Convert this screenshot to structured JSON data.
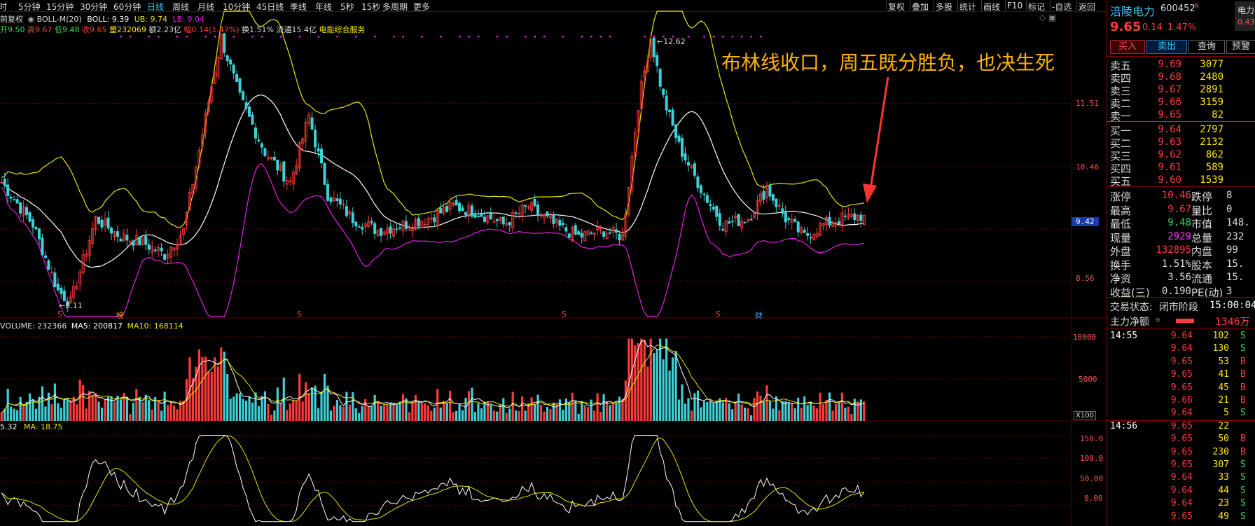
{
  "toolbar": {
    "periods": [
      "分时",
      "5分钟",
      "15分钟",
      "30分钟",
      "60分钟",
      "日线",
      "周线",
      "月线",
      "10分钟",
      "45日线",
      "季线",
      "年线",
      "5秒",
      "15秒",
      "多周期",
      "更多"
    ],
    "active_period": "日线",
    "tools": [
      "复权",
      "叠加",
      "多股",
      "统计",
      "画线",
      "F10",
      "标记",
      "-自选",
      "返回"
    ]
  },
  "main_panel": {
    "indicator_header": {
      "prefix": "前复权",
      "name": "BOLL-M(20)",
      "boll_label": "BOLL: 9.39",
      "ub_label": "UB: 9.74",
      "lb_label": "LB: 9.04"
    },
    "quote_line": {
      "open": "开9.50",
      "high": "高9.67",
      "low": "低9.48",
      "close": "收9.65",
      "volume": "量232069",
      "amount": "额2.23亿",
      "change": "幅0.14(1.47%)",
      "turnover": "换1.51%",
      "float_cap": "流通15.4亿",
      "concept": "电能综合服务"
    },
    "annotation": "布林线收口，周五既分胜负，也决生死",
    "price_axis": [
      "11.51",
      "10.46",
      "9.42",
      "8.56"
    ],
    "current_price_tag": "9.42",
    "high_marker": "12.62",
    "low_marker": "8.11",
    "event_markers": [
      {
        "label": "S",
        "color": "#e04040"
      },
      {
        "label": "榜",
        "color": "#ff9900"
      },
      {
        "label": "S",
        "color": "#e04040"
      },
      {
        "label": "S",
        "color": "#e04040"
      },
      {
        "label": "S",
        "color": "#e04040"
      },
      {
        "label": "财",
        "color": "#4aa8ff"
      }
    ],
    "colors": {
      "up": "#ff3b3b",
      "down": "#3fd0d8",
      "ub": "#e6e600",
      "mid": "#ffffff",
      "lb": "#e020e0",
      "grid": "#5a0000",
      "dash": "#7a0000"
    }
  },
  "volume_panel": {
    "header": {
      "name": "VOLUME: 232366",
      "ma5": "MA5: 200817",
      "ma10": "MA10: 168114"
    },
    "axis": [
      "10000",
      "5000",
      "X100"
    ]
  },
  "osc_panel": {
    "header": {
      "value": "5.32",
      "ma": "MA: 18.75"
    },
    "axis": [
      "150.0",
      "100.0",
      "50.00",
      "0.00"
    ]
  },
  "quote_panel": {
    "stock_name": "涪陵电力",
    "code": "600452",
    "badge": "R",
    "side_tab": "电力",
    "side_value": "0.43",
    "price": "9.65",
    "change": "0.14",
    "change_pct": "1.47%",
    "buttons": [
      "买入",
      "卖出",
      "查询",
      "预警"
    ],
    "asks": [
      {
        "label": "卖五",
        "price": "9.69",
        "vol": "3077"
      },
      {
        "label": "卖四",
        "price": "9.68",
        "vol": "2480"
      },
      {
        "label": "卖三",
        "price": "9.67",
        "vol": "2891"
      },
      {
        "label": "卖二",
        "price": "9.66",
        "vol": "3159"
      },
      {
        "label": "卖一",
        "price": "9.65",
        "vol": "82"
      }
    ],
    "bids": [
      {
        "label": "买一",
        "price": "9.64",
        "vol": "2797"
      },
      {
        "label": "买二",
        "price": "9.63",
        "vol": "2132"
      },
      {
        "label": "买三",
        "price": "9.62",
        "vol": "862"
      },
      {
        "label": "买四",
        "price": "9.61",
        "vol": "589"
      },
      {
        "label": "买五",
        "price": "9.60",
        "vol": "1539"
      }
    ],
    "stats": [
      {
        "l1": "涨停",
        "v1": "10.46",
        "c1": "#ff3b3b",
        "l2": "跌停",
        "v2": "8"
      },
      {
        "l1": "最高",
        "v1": "9.67",
        "c1": "#ff3b3b",
        "l2": "量比",
        "v2": "0"
      },
      {
        "l1": "最低",
        "v1": "9.48",
        "c1": "#33dd55",
        "l2": "市值",
        "v2": "148."
      },
      {
        "l1": "现量",
        "v1": "2929",
        "c1": "#ff33ff",
        "l2": "总量",
        "v2": "232"
      },
      {
        "l1": "外盘",
        "v1": "132895",
        "c1": "#ff3b3b",
        "l2": "内盘",
        "v2": "99"
      },
      {
        "l1": "换手",
        "v1": "1.51%",
        "c1": "#dddddd",
        "l2": "股本",
        "v2": "15."
      },
      {
        "l1": "净资",
        "v1": "3.56",
        "c1": "#dddddd",
        "l2": "流通",
        "v2": "15."
      },
      {
        "l1": "收益(三)",
        "v1": "0.190",
        "c1": "#dddddd",
        "l2": "PE(动)",
        "v2": "3"
      }
    ],
    "trade_status_label": "交易状态:",
    "trade_status": "闭市阶段",
    "trade_time": "15:00:04",
    "main_flow_label": "主力净额",
    "main_flow_value": "1346万",
    "ticks": [
      {
        "time": "14:55",
        "price": "9.64",
        "vol": "102",
        "side": "S"
      },
      {
        "time": "",
        "price": "9.64",
        "vol": "130",
        "side": "S"
      },
      {
        "time": "",
        "price": "9.65",
        "vol": "53",
        "side": "B"
      },
      {
        "time": "",
        "price": "9.65",
        "vol": "41",
        "side": "B"
      },
      {
        "time": "",
        "price": "9.65",
        "vol": "45",
        "side": "B"
      },
      {
        "time": "",
        "price": "9.66",
        "vol": "21",
        "side": "B"
      },
      {
        "time": "",
        "price": "9.64",
        "vol": "5",
        "side": "S"
      },
      {
        "time": "14:56",
        "price": "9.65",
        "vol": "22",
        "side": ""
      },
      {
        "time": "",
        "price": "9.65",
        "vol": "50",
        "side": "B"
      },
      {
        "time": "",
        "price": "9.65",
        "vol": "230",
        "side": "B"
      },
      {
        "time": "",
        "price": "9.65",
        "vol": "307",
        "side": "S"
      },
      {
        "time": "",
        "price": "9.64",
        "vol": "33",
        "side": "S"
      },
      {
        "time": "",
        "price": "9.64",
        "vol": "44",
        "side": "S"
      },
      {
        "time": "",
        "price": "9.64",
        "vol": "23",
        "side": "S"
      },
      {
        "time": "",
        "price": "9.65",
        "vol": "49",
        "side": "S"
      }
    ]
  },
  "chart_data": {
    "type": "candlestick",
    "title": "涪陵电力 600452 日线",
    "indicator": "BOLL-M(20)",
    "ylim": [
      8.11,
      12.62
    ],
    "price_ticks": [
      11.51,
      10.46,
      9.42,
      8.56
    ],
    "latest": {
      "open": 9.5,
      "high": 9.67,
      "low": 9.48,
      "close": 9.65,
      "boll": 9.39,
      "ub": 9.74,
      "lb": 9.04
    },
    "anchors": [
      {
        "i": 0,
        "p": 10.2
      },
      {
        "i": 10,
        "p": 9.5
      },
      {
        "i": 18,
        "p": 8.4
      },
      {
        "i": 22,
        "p": 8.2
      },
      {
        "i": 30,
        "p": 9.6
      },
      {
        "i": 38,
        "p": 9.3
      },
      {
        "i": 45,
        "p": 9.2
      },
      {
        "i": 52,
        "p": 9.0
      },
      {
        "i": 58,
        "p": 9.4
      },
      {
        "i": 64,
        "p": 11.0
      },
      {
        "i": 70,
        "p": 12.6
      },
      {
        "i": 76,
        "p": 11.6
      },
      {
        "i": 84,
        "p": 10.7
      },
      {
        "i": 92,
        "p": 10.2
      },
      {
        "i": 98,
        "p": 11.3
      },
      {
        "i": 104,
        "p": 10.0
      },
      {
        "i": 112,
        "p": 9.6
      },
      {
        "i": 120,
        "p": 9.4
      },
      {
        "i": 128,
        "p": 9.5
      },
      {
        "i": 136,
        "p": 9.6
      },
      {
        "i": 144,
        "p": 9.8
      },
      {
        "i": 152,
        "p": 9.7
      },
      {
        "i": 160,
        "p": 9.5
      },
      {
        "i": 168,
        "p": 9.8
      },
      {
        "i": 176,
        "p": 9.5
      },
      {
        "i": 184,
        "p": 9.3
      },
      {
        "i": 192,
        "p": 9.4
      },
      {
        "i": 198,
        "p": 9.3
      },
      {
        "i": 203,
        "p": 11.5
      },
      {
        "i": 207,
        "p": 12.6
      },
      {
        "i": 211,
        "p": 11.6
      },
      {
        "i": 216,
        "p": 10.8
      },
      {
        "i": 224,
        "p": 10.0
      },
      {
        "i": 230,
        "p": 9.5
      },
      {
        "i": 238,
        "p": 9.6
      },
      {
        "i": 244,
        "p": 10.1
      },
      {
        "i": 250,
        "p": 9.6
      },
      {
        "i": 256,
        "p": 9.3
      },
      {
        "i": 262,
        "p": 9.5
      },
      {
        "i": 268,
        "p": 9.6
      },
      {
        "i": 275,
        "p": 9.65
      }
    ],
    "volume_ylim": [
      0,
      10000
    ],
    "osc_ylim": [
      -40,
      160
    ]
  }
}
